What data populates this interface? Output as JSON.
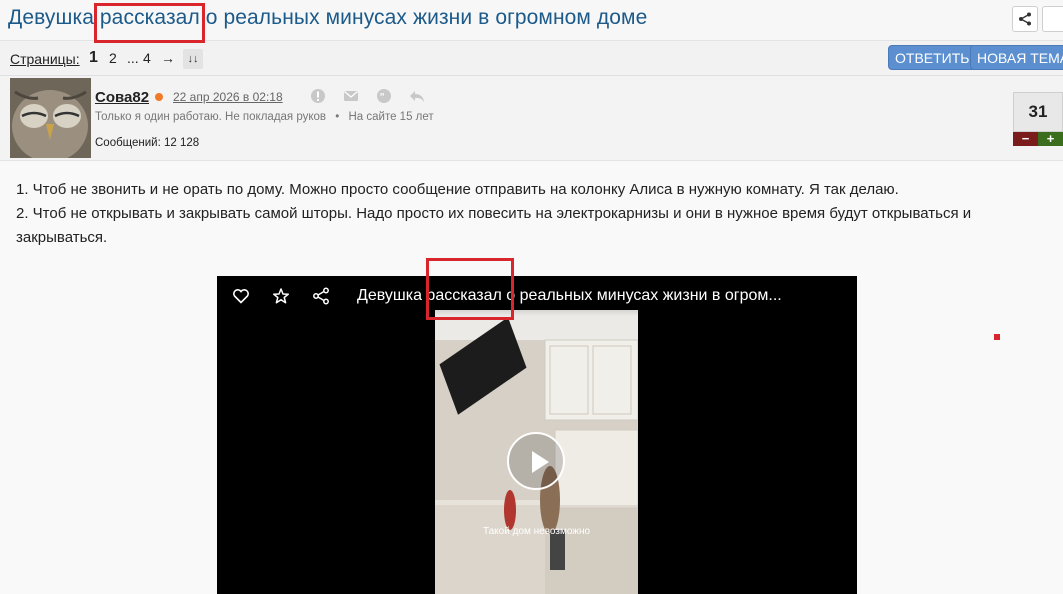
{
  "topic": {
    "title": "Девушка рассказал о реальных минусах жизни в огромном доме"
  },
  "pager": {
    "label": "Страницы:",
    "pages": [
      "1",
      "2",
      "...",
      "4",
      "→",
      "↓↓"
    ],
    "reply_label": "ОТВЕТИТЬ",
    "new_topic_label": "НОВАЯ ТЕМА"
  },
  "post": {
    "author": "Сова82",
    "date": "22 апр 2026 в 02:18",
    "status": "Только я один работаю. Не покладая руков",
    "status_sep": "•",
    "on_site": "На сайте 15 лет",
    "messages": "Сообщений: 12 128",
    "rating": "31",
    "rating_minus": "−",
    "rating_plus": "+",
    "text_line1": "1. Чтоб не звонить и не орать по дому. Можно просто сообщение отправить на колонку Алиса в нужную комнату. Я так делаю.",
    "text_line2": "2. Чтоб не открывать и закрывать самой шторы. Надо просто их повесить на электрокарнизы и они в нужное время будут открываться и закрываться."
  },
  "video": {
    "title": "Девушка рассказал о реальных минусах жизни в огром...",
    "caption": "Такой дом невозможно"
  },
  "colors": {
    "accent": "#5b8fd0",
    "title": "#1c5a8a",
    "highlight": "#d9262c",
    "online": "#f07a27"
  }
}
